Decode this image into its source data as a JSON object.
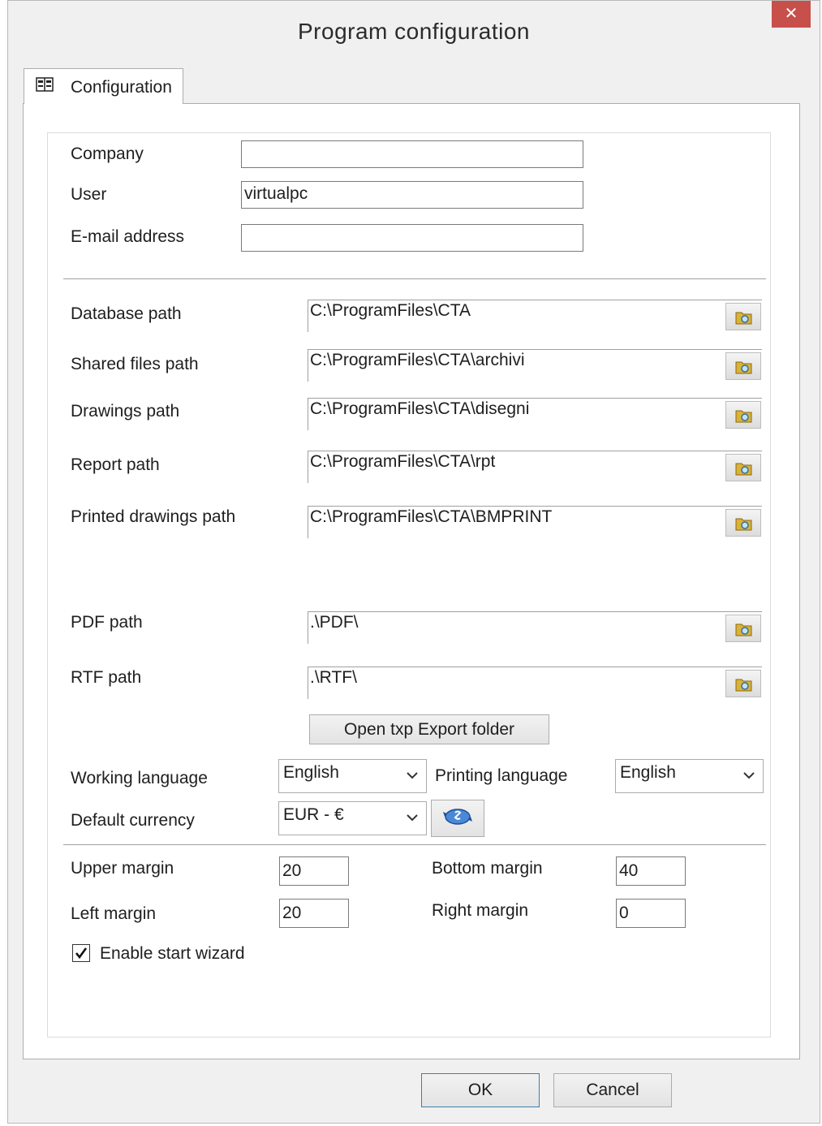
{
  "window": {
    "title": "Program configuration"
  },
  "tabs": [
    {
      "label": "Configuration"
    }
  ],
  "user_info": {
    "company_label": "Company",
    "company_value": "",
    "user_label": "User",
    "user_value": "virtualpc",
    "email_label": "E-mail address",
    "email_value": ""
  },
  "paths": [
    {
      "label": "Database path",
      "value": "C:\\ProgramFiles\\CTA"
    },
    {
      "label": "Shared files path",
      "value": "C:\\ProgramFiles\\CTA\\archivi"
    },
    {
      "label": "Drawings path",
      "value": "C:\\ProgramFiles\\CTA\\disegni"
    },
    {
      "label": "Report path",
      "value": "C:\\ProgramFiles\\CTA\\rpt"
    },
    {
      "label": "Printed drawings path",
      "value": "C:\\ProgramFiles\\CTA\\BMPRINT"
    },
    {
      "label": "PDF path",
      "value": ".\\PDF\\"
    },
    {
      "label": "RTF path",
      "value": ".\\RTF\\"
    }
  ],
  "export_button": "Open txp Export folder",
  "language": {
    "working_label": "Working language",
    "working_value": "English",
    "printing_label": "Printing language",
    "printing_value": "English"
  },
  "currency": {
    "label": "Default currency",
    "value": "EUR - €"
  },
  "margins": {
    "upper_label": "Upper margin",
    "upper_value": "20",
    "bottom_label": "Bottom margin",
    "bottom_value": "40",
    "left_label": "Left margin",
    "left_value": "20",
    "right_label": "Right margin",
    "right_value": "0"
  },
  "wizard": {
    "label": "Enable start wizard",
    "checked": true
  },
  "footer": {
    "ok_label": "OK",
    "cancel_label": "Cancel"
  },
  "icons": {
    "close": "close-icon",
    "tab": "config-book-icon",
    "browse": "folder-browse-icon",
    "currency": "currency-exchange-icon",
    "dropdown": "chevron-down-icon",
    "check": "checkmark-icon"
  },
  "colors": {
    "close_button": "#c7504a",
    "ok_border": "#3c7fb1"
  }
}
